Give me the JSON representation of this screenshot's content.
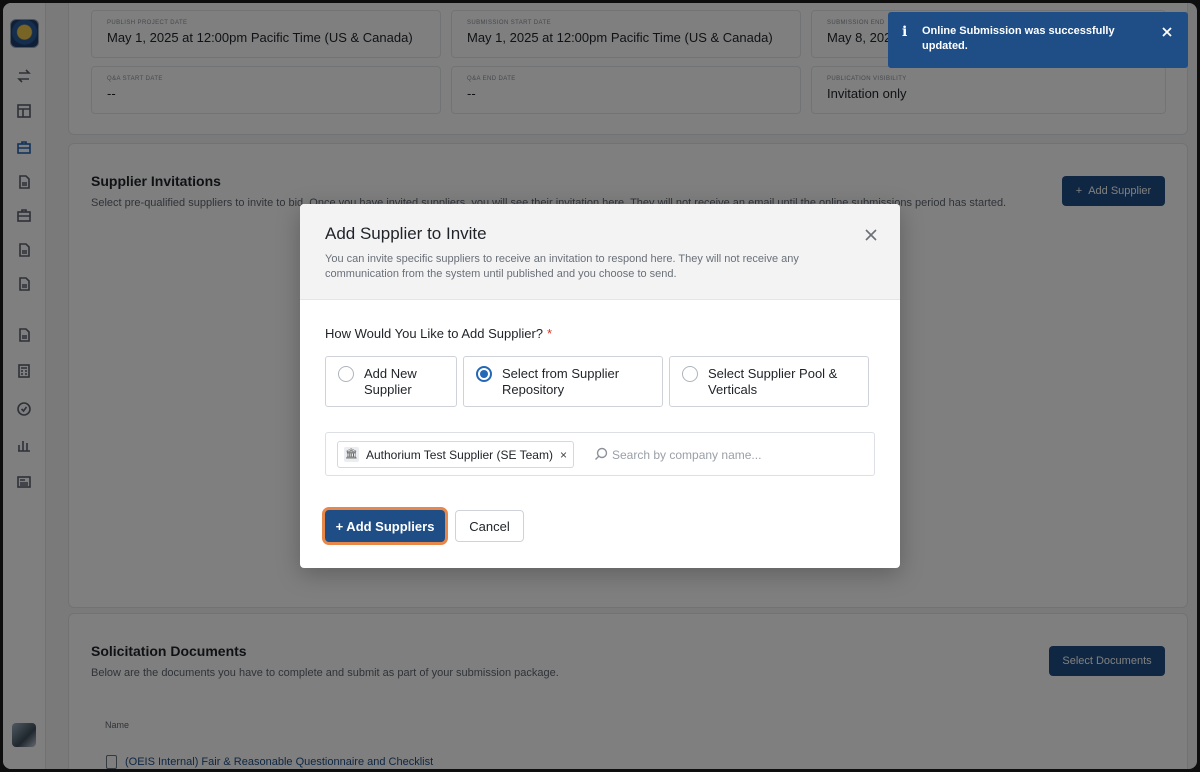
{
  "dates": [
    {
      "label": "PUBLISH PROJECT DATE",
      "value": "May 1, 2025 at 12:00pm Pacific Time (US & Canada)"
    },
    {
      "label": "SUBMISSION START DATE",
      "value": "May 1, 2025 at 12:00pm Pacific Time (US & Canada)"
    },
    {
      "label": "SUBMISSION END",
      "value": "May 8, 202"
    },
    {
      "label": "Q&A START DATE",
      "value": "--"
    },
    {
      "label": "Q&A END DATE",
      "value": "--"
    },
    {
      "label": "PUBLICATION VISIBILITY",
      "value": "Invitation only"
    }
  ],
  "supplier_invitations": {
    "title": "Supplier Invitations",
    "description": "Select pre-qualified suppliers to invite to bid. Once you have invited suppliers, you will see their invitation here. They will not receive an email until the online submissions period has started.",
    "add_button": "Add Supplier"
  },
  "solicitation_documents": {
    "title": "Solicitation Documents",
    "description": "Below are the documents you have to complete and submit as part of your submission package.",
    "select_button": "Select Documents",
    "table_header": "Name",
    "rows": [
      "(OEIS Internal) Fair & Reasonable Questionnaire and Checklist"
    ]
  },
  "modal": {
    "title": "Add Supplier to Invite",
    "description": "You can invite specific suppliers to receive an invitation to respond here. They will not receive any communication from the system until published and you choose to send.",
    "question": "How Would You Like to Add Supplier?",
    "required_mark": "*",
    "options": [
      {
        "label": "Add New Supplier",
        "checked": false
      },
      {
        "label": "Select from Supplier Repository",
        "checked": true
      },
      {
        "label": "Select Supplier Pool & Verticals",
        "checked": false
      }
    ],
    "selected_chip": "Authorium Test Supplier (SE Team)",
    "search_placeholder": "Search by company name...",
    "primary_button": "+ Add Suppliers",
    "secondary_button": "Cancel"
  },
  "toast": {
    "message": "Online Submission was successfully updated."
  },
  "icons": {
    "toast": "info-icon",
    "close": "close-icon",
    "search": "search-icon",
    "chip": "bank-icon"
  },
  "colors": {
    "primary": "#1f4e87",
    "radio_selected": "#2467b8",
    "focus_ring": "#e8874a",
    "required": "#d93025"
  }
}
